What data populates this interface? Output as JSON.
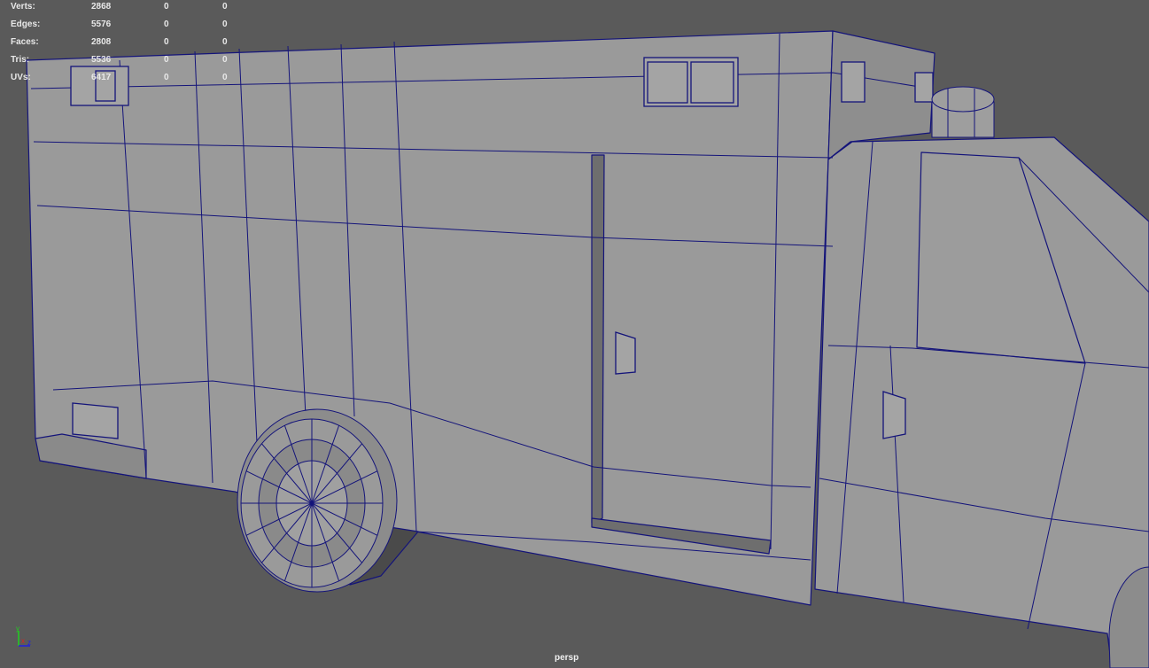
{
  "hud": {
    "rows": [
      {
        "label": "Verts:",
        "values": [
          "2868",
          "0",
          "0"
        ]
      },
      {
        "label": "Edges:",
        "values": [
          "5576",
          "0",
          "0"
        ]
      },
      {
        "label": "Faces:",
        "values": [
          "2808",
          "0",
          "0"
        ]
      },
      {
        "label": "Tris:",
        "values": [
          "5536",
          "0",
          "0"
        ]
      },
      {
        "label": "UVs:",
        "values": [
          "6417",
          "0",
          "0"
        ]
      }
    ]
  },
  "camera_label": "persp",
  "axis": {
    "y": "y",
    "x": "x",
    "z": "z"
  },
  "colors": {
    "background": "#5a5a5a",
    "mesh": "#9a9a9a",
    "wire": "#14147a"
  }
}
